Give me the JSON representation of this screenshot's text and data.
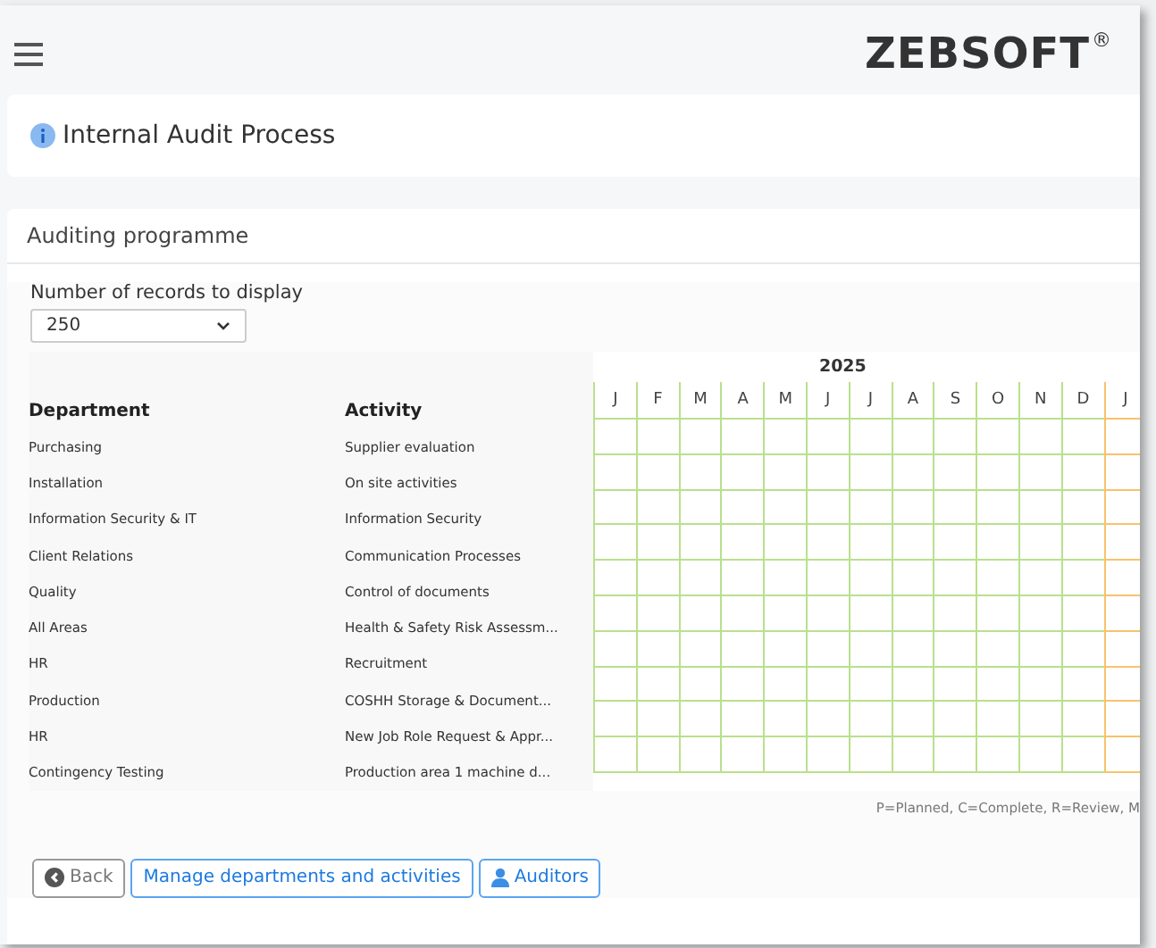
{
  "header": {
    "logo": "ZEBSOFT",
    "logo_mark": "®"
  },
  "title": "Internal Audit Process",
  "section": {
    "title": "Auditing programme"
  },
  "records": {
    "label": "Number of records to display",
    "value": "250"
  },
  "table": {
    "columns": [
      "Department",
      "Activity"
    ],
    "year": "2025",
    "months": [
      {
        "label": "J",
        "kind": "current"
      },
      {
        "label": "F",
        "kind": "current"
      },
      {
        "label": "M",
        "kind": "current"
      },
      {
        "label": "A",
        "kind": "current"
      },
      {
        "label": "M",
        "kind": "current"
      },
      {
        "label": "J",
        "kind": "current"
      },
      {
        "label": "J",
        "kind": "current"
      },
      {
        "label": "A",
        "kind": "current"
      },
      {
        "label": "S",
        "kind": "current"
      },
      {
        "label": "O",
        "kind": "current"
      },
      {
        "label": "N",
        "kind": "current"
      },
      {
        "label": "D",
        "kind": "current"
      },
      {
        "label": "J",
        "kind": "next"
      }
    ],
    "rows": [
      {
        "department": "Purchasing",
        "activity": "Supplier evaluation"
      },
      {
        "department": "Installation",
        "activity": "On site activities"
      },
      {
        "department": "Information Security & IT",
        "activity": "Information Security"
      },
      {
        "department": "Client Relations",
        "activity": "Communication Processes"
      },
      {
        "department": "Quality",
        "activity": "Control of documents"
      },
      {
        "department": "All Areas",
        "activity": "Health & Safety Risk Assessm..."
      },
      {
        "department": "HR",
        "activity": "Recruitment"
      },
      {
        "department": "Production",
        "activity": "COSHH Storage & Document..."
      },
      {
        "department": "HR",
        "activity": "New Job Role Request & Appr..."
      },
      {
        "department": "Contingency Testing",
        "activity": "Production area 1 machine d..."
      }
    ]
  },
  "legend": "P=Planned, C=Complete, R=Review, M",
  "buttons": [
    {
      "label": "Back",
      "kind": "back"
    },
    {
      "label": "Manage departments and activities",
      "kind": "primary"
    },
    {
      "label": "Auditors",
      "kind": "auditors"
    }
  ]
}
